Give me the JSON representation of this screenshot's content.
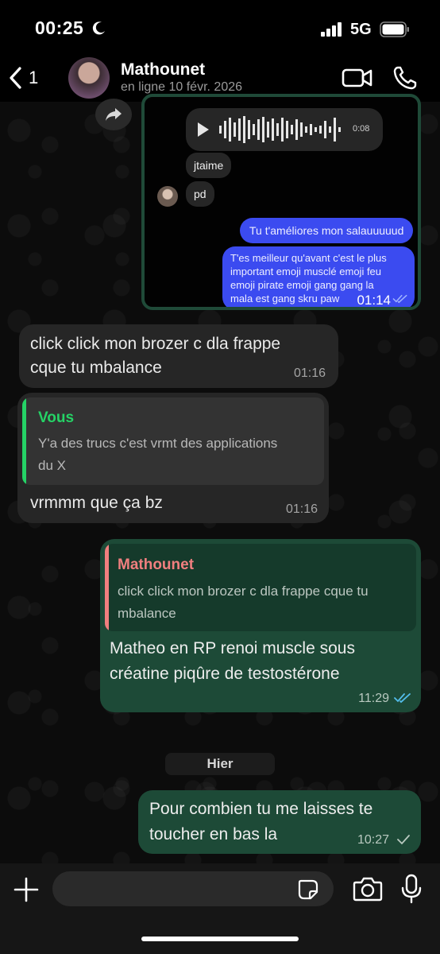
{
  "status_bar": {
    "time": "00:25",
    "network": "5G"
  },
  "header": {
    "back_count": "1",
    "contact_name": "Mathounet",
    "contact_status": "en ligne 10 févr. 2026"
  },
  "shared_image": {
    "voice_note_duration": "0:08",
    "incoming": [
      "jtaime",
      "pd"
    ],
    "outgoing_short": "Tu t'améliores mon salauuuuud",
    "outgoing_long_lines": [
      "T'es meilleur qu'avant c'est le plus",
      "important emoji musclé emoji feu",
      "emoji pirate emoji gang gang la",
      "mala est gang skru paw"
    ],
    "outgoing_long_time": "01:14"
  },
  "messages": [
    {
      "direction": "in",
      "lines": [
        "click click mon brozer c dla frappe",
        "cque tu mbalance"
      ],
      "time": "01:16"
    },
    {
      "direction": "in",
      "quote_author": "Vous",
      "quote_lines": [
        "Y'a des trucs c'est vrmt des applications",
        "du X"
      ],
      "lines": [
        "vrmmm que ça bz"
      ],
      "time": "01:16"
    },
    {
      "direction": "out",
      "quote_author": "Mathounet",
      "quote_lines": [
        "click click mon brozer c dla frappe cque tu",
        "mbalance"
      ],
      "lines": [
        "Matheo en RP renoi muscle sous",
        "créatine piqûre de testostérone"
      ],
      "time": "11:29",
      "status": "read"
    },
    {
      "direction": "out",
      "lines": [
        "Pour combien tu me laisses te",
        "toucher en bas la"
      ],
      "time": "10:27",
      "status": "delivered"
    }
  ],
  "date_separator": "Hier",
  "composer": {
    "placeholder": ""
  },
  "colors": {
    "outgoing_bubble": "#1d4a37",
    "incoming_bubble": "#262626",
    "quote_you": "#25d366",
    "quote_contact": "#f07f7f",
    "read_ticks": "#53bdeb"
  }
}
